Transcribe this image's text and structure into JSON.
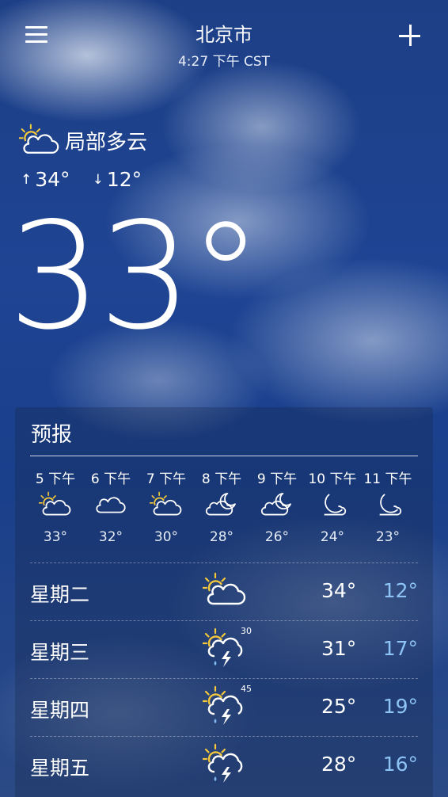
{
  "header": {
    "city": "北京市",
    "time": "4:27 下午 CST"
  },
  "current": {
    "condition": "局部多云",
    "icon": "partly-cloudy-day-icon",
    "high": "34°",
    "low": "12°",
    "temp": "33°"
  },
  "forecast": {
    "title": "预报",
    "hourly": [
      {
        "time": "5 下午",
        "icon": "partly-cloudy-day-icon",
        "temp": "33°"
      },
      {
        "time": "6 下午",
        "icon": "cloud-icon",
        "temp": "32°"
      },
      {
        "time": "7 下午",
        "icon": "partly-cloudy-day-icon",
        "temp": "30°"
      },
      {
        "time": "8 下午",
        "icon": "partly-cloudy-night-icon",
        "temp": "28°"
      },
      {
        "time": "9 下午",
        "icon": "partly-cloudy-night-icon",
        "temp": "26°"
      },
      {
        "time": "10 下午",
        "icon": "moon-cloud-icon",
        "temp": "24°"
      },
      {
        "time": "11 下午",
        "icon": "moon-cloud-icon",
        "temp": "23°"
      }
    ],
    "daily": [
      {
        "day": "星期二",
        "icon": "partly-cloudy-day-icon",
        "precip": "",
        "high": "34°",
        "low": "12°"
      },
      {
        "day": "星期三",
        "icon": "thunderstorm-icon",
        "precip": "30",
        "high": "31°",
        "low": "17°"
      },
      {
        "day": "星期四",
        "icon": "thunderstorm-icon",
        "precip": "45",
        "high": "25°",
        "low": "19°"
      },
      {
        "day": "星期五",
        "icon": "thunderstorm-icon",
        "precip": "",
        "high": "28°",
        "low": "16°"
      }
    ]
  },
  "colors": {
    "low_temp": "#8ec3f6",
    "sun": "#f5c93a",
    "rain": "#7fb8ee"
  }
}
